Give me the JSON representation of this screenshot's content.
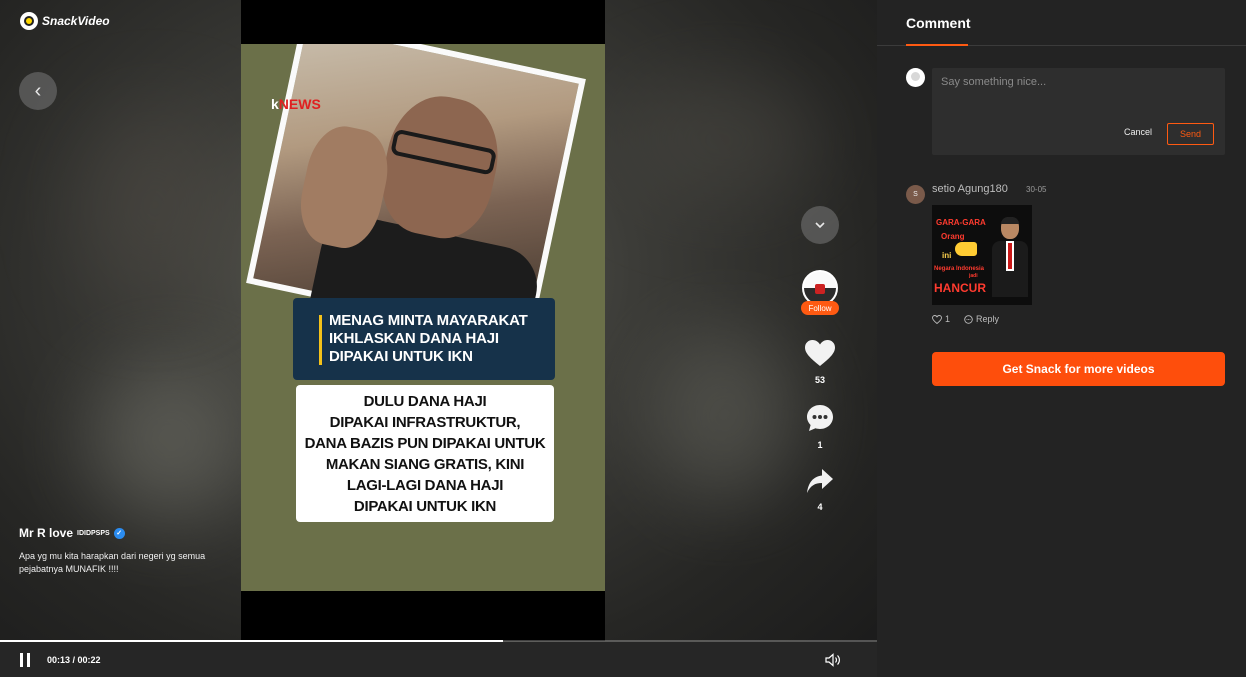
{
  "brand": {
    "logo_text": "SnackVideo"
  },
  "player": {
    "watermark": {
      "prefix": "k",
      "text": "NEWS"
    },
    "caption_dark": "MENAG MINTA MAYARAKAT\nIKHLASKAN DANA HAJI\nDIPAKAI UNTUK IKN",
    "caption_white": "DULU DANA HAJI\nDIPAKAI INFRASTRUKTUR,\nDANA BAZIS PUN DIPAKAI UNTUK\nMAKAN SIANG GRATIS, KINI\nLAGI-LAGI DANA HAJI\nDIPAKAI UNTUK IKN",
    "author_name": "Mr R love",
    "author_tag": "IDIDPSPS",
    "description": "Apa yg mu kita harapkan dari negeri yg semua pejabatnya MUNAFIK !!!!",
    "time": "00:13 / 00:22",
    "progress": 0.574
  },
  "rail": {
    "follow_label": "Follow",
    "likes": "53",
    "comments": "1",
    "shares": "4"
  },
  "panel": {
    "title": "Comment",
    "input_placeholder": "Say something nice...",
    "cancel_label": "Cancel",
    "send_label": "Send",
    "cta_label": "Get Snack for more videos"
  },
  "comments": [
    {
      "avatar_letter": "S",
      "user": "setio Agung180",
      "date": "30-05",
      "image_text": {
        "line1": "GARA-GARA",
        "line2": "Orang",
        "line3": "ini",
        "line4": "Negara Indonesia",
        "line5": "jadi",
        "line6": "HANCUR"
      },
      "likes": "1",
      "reply_label": "Reply"
    }
  ],
  "colors": {
    "accent": "#fe5a12",
    "panel_bg": "#232323",
    "verified": "#2b8cf0"
  }
}
